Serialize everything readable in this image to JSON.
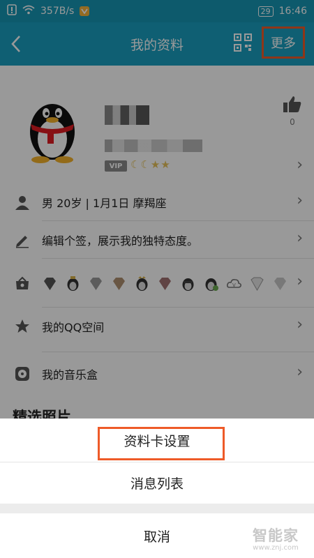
{
  "status_bar": {
    "network_speed": "357B/s",
    "battery_level": "29",
    "time": "16:46"
  },
  "header": {
    "title": "我的资料",
    "more_label": "更多"
  },
  "profile": {
    "vip_label": "VIP",
    "likes_count": "0"
  },
  "rows": {
    "info": "男  20岁  |  1月1日  摩羯座",
    "signature": "编辑个签，展示我的独特态度。",
    "qzone": "我的QQ空间",
    "music": "我的音乐盒"
  },
  "photos_section_title": "精选照片",
  "action_sheet": {
    "card_settings": "资料卡设置",
    "message_list": "消息列表",
    "cancel": "取消"
  },
  "watermark": {
    "name": "智能家",
    "url": "www.znj.com"
  },
  "colors": {
    "header_bg": "#1a9fc0",
    "highlight": "#ee5a28"
  }
}
